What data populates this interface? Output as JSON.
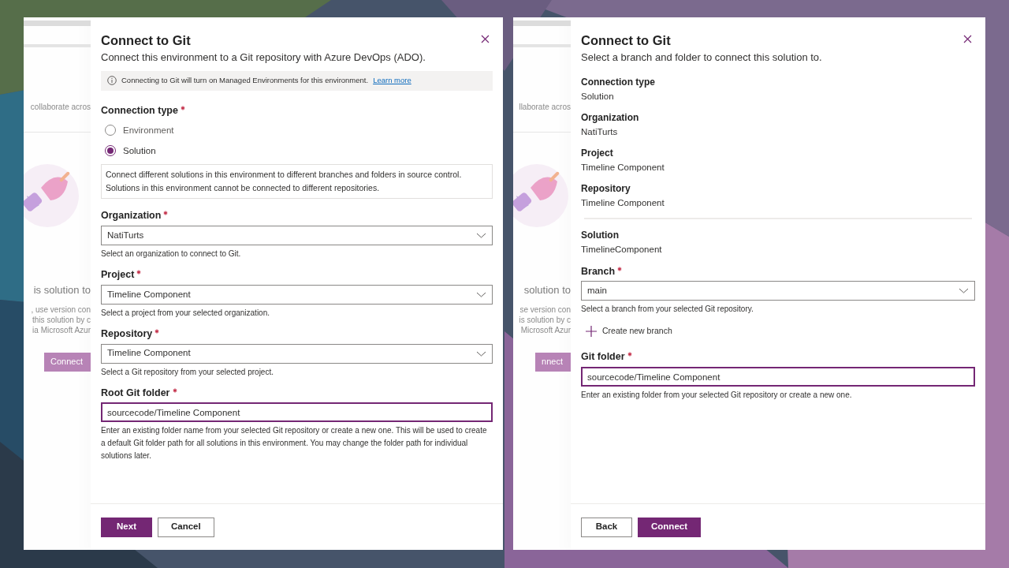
{
  "panels": [
    {
      "backdrop": {
        "texts": [
          {
            "kind": "small",
            "text": "collaborate acros"
          },
          {
            "kind": "heading",
            "text": "is solution to"
          },
          {
            "kind": "body",
            "text": ", use version con"
          },
          {
            "kind": "body",
            "text": "this solution by c"
          },
          {
            "kind": "body",
            "text": "ia Microsoft Azur"
          }
        ],
        "button": "Connect"
      },
      "dialog": {
        "title": "Connect to Git",
        "subtitle": "Connect this environment to a Git repository with Azure DevOps (ADO).",
        "notice": {
          "text": "Connecting to Git will turn on Managed Environments for this environment.",
          "link": "Learn more"
        },
        "fields": [
          {
            "kind": "radio_group",
            "label": "Connection type",
            "required": true,
            "options": [
              {
                "label": "Environment",
                "selected": false
              },
              {
                "label": "Solution",
                "selected": true
              }
            ]
          },
          {
            "kind": "info_box",
            "text": "Connect different solutions in this environment to different branches and folders in source control. Solutions in this environment cannot be connected to different repositories."
          },
          {
            "kind": "dropdown",
            "label": "Organization",
            "required": true,
            "value": "NatiTurts",
            "hint": "Select an organization to connect to Git."
          },
          {
            "kind": "dropdown",
            "label": "Project",
            "required": true,
            "value": "Timeline Component",
            "hint": "Select a project from your selected organization."
          },
          {
            "kind": "dropdown",
            "label": "Repository",
            "required": true,
            "value": "Timeline Component",
            "hint": "Select a Git repository from your selected project."
          },
          {
            "kind": "text_input",
            "label": "Root Git folder",
            "required": true,
            "value": "sourcecode/Timeline Component",
            "focused": true,
            "hint": "Enter an existing folder name from your selected Git repository or create a new one. This will be used to create a default Git folder path for all solutions in this environment. You may change the folder path for individual solutions later."
          }
        ],
        "buttons": [
          {
            "label": "Next",
            "kind": "primary"
          },
          {
            "label": "Cancel",
            "kind": "secondary"
          }
        ]
      }
    },
    {
      "backdrop": {
        "texts": [
          {
            "kind": "small",
            "text": "llaborate acros"
          },
          {
            "kind": "heading",
            "text": "solution to"
          },
          {
            "kind": "body",
            "text": "se version con"
          },
          {
            "kind": "body",
            "text": "is solution by c"
          },
          {
            "kind": "body",
            "text": "Microsoft Azur"
          }
        ],
        "button": "nnect"
      },
      "dialog": {
        "title": "Connect to Git",
        "subtitle": "Select a branch and folder to connect this solution to.",
        "fields": [
          {
            "kind": "readonly",
            "label": "Connection type",
            "value": "Solution"
          },
          {
            "kind": "readonly",
            "label": "Organization",
            "value": "NatiTurts"
          },
          {
            "kind": "readonly",
            "label": "Project",
            "value": "Timeline Component"
          },
          {
            "kind": "readonly",
            "label": "Repository",
            "value": "Timeline Component"
          },
          {
            "kind": "divider"
          },
          {
            "kind": "readonly",
            "label": "Solution",
            "value": "TimelineComponent"
          },
          {
            "kind": "dropdown",
            "label": "Branch",
            "required": true,
            "value": "main",
            "hint": "Select a branch from your selected Git repository."
          },
          {
            "kind": "action",
            "label": "Create new branch"
          },
          {
            "kind": "text_input",
            "label": "Git folder",
            "required": true,
            "value": "sourcecode/Timeline Component",
            "focused": true,
            "hint": "Enter an existing folder from your selected Git repository or create a new one."
          }
        ],
        "buttons": [
          {
            "label": "Back",
            "kind": "secondary"
          },
          {
            "label": "Connect",
            "kind": "primary"
          }
        ]
      }
    }
  ]
}
